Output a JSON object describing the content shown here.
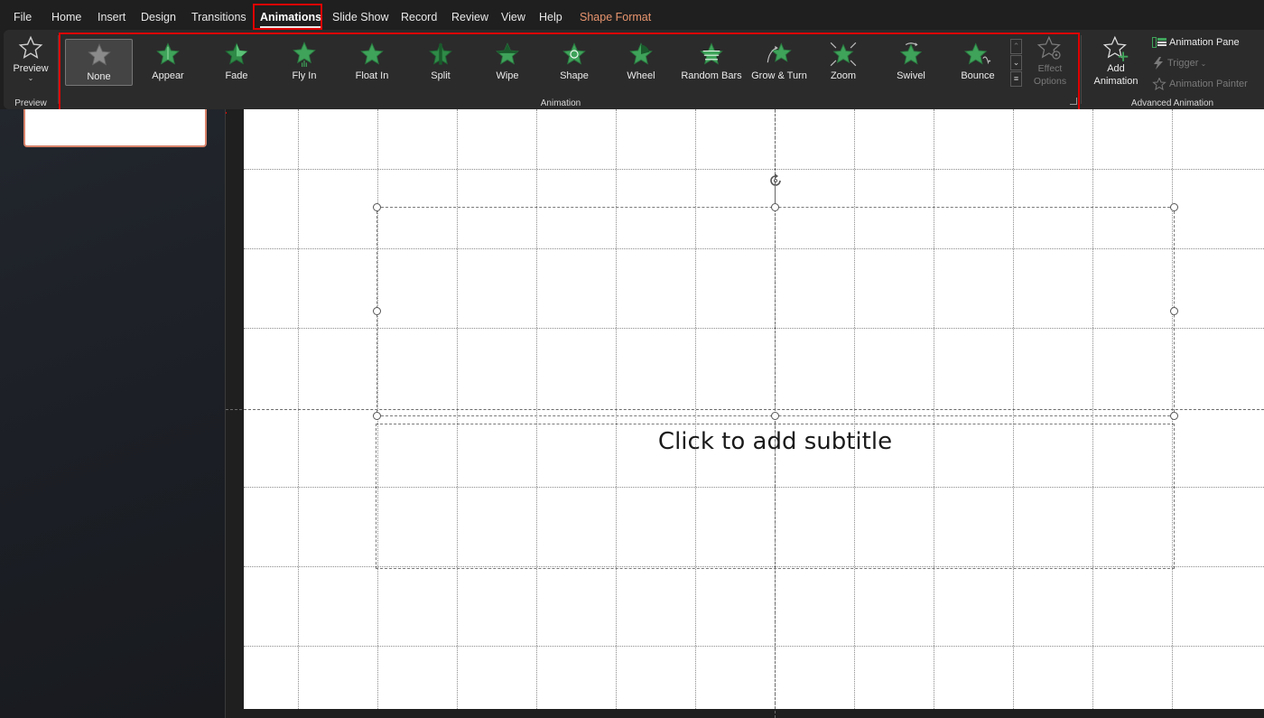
{
  "menu": {
    "tabs": [
      {
        "label": "File"
      },
      {
        "label": "Home"
      },
      {
        "label": "Insert"
      },
      {
        "label": "Design"
      },
      {
        "label": "Transitions"
      },
      {
        "label": "Animations"
      },
      {
        "label": "Slide Show"
      },
      {
        "label": "Record"
      },
      {
        "label": "Review"
      },
      {
        "label": "View"
      },
      {
        "label": "Help"
      },
      {
        "label": "Shape Format"
      }
    ],
    "active_tab": "Animations"
  },
  "ribbon": {
    "preview": {
      "button_label": "Preview",
      "group_label": "Preview",
      "icon": "star-outline-icon"
    },
    "animation_group": {
      "group_label": "Animation",
      "effects": [
        {
          "label": "None",
          "selected": true
        },
        {
          "label": "Appear"
        },
        {
          "label": "Fade"
        },
        {
          "label": "Fly In"
        },
        {
          "label": "Float In"
        },
        {
          "label": "Split"
        },
        {
          "label": "Wipe"
        },
        {
          "label": "Shape"
        },
        {
          "label": "Wheel"
        },
        {
          "label": "Random Bars"
        },
        {
          "label": "Grow & Turn"
        },
        {
          "label": "Zoom"
        },
        {
          "label": "Swivel"
        },
        {
          "label": "Bounce"
        }
      ],
      "effect_options": {
        "line1": "Effect",
        "line2": "Options"
      }
    },
    "advanced_group": {
      "group_label": "Advanced Animation",
      "add_animation": {
        "line1": "Add",
        "line2": "Animation"
      },
      "animation_pane": "Animation Pane",
      "trigger": "Trigger",
      "animation_painter": "Animation Painter"
    }
  },
  "slide": {
    "subtitle_placeholder": "Click to add subtitle"
  },
  "colors": {
    "accent_star": "#3fa35a",
    "highlight_box": "#e00000",
    "contextual_tab": "#e8956e",
    "thumbnail_border": "#d8826a"
  }
}
